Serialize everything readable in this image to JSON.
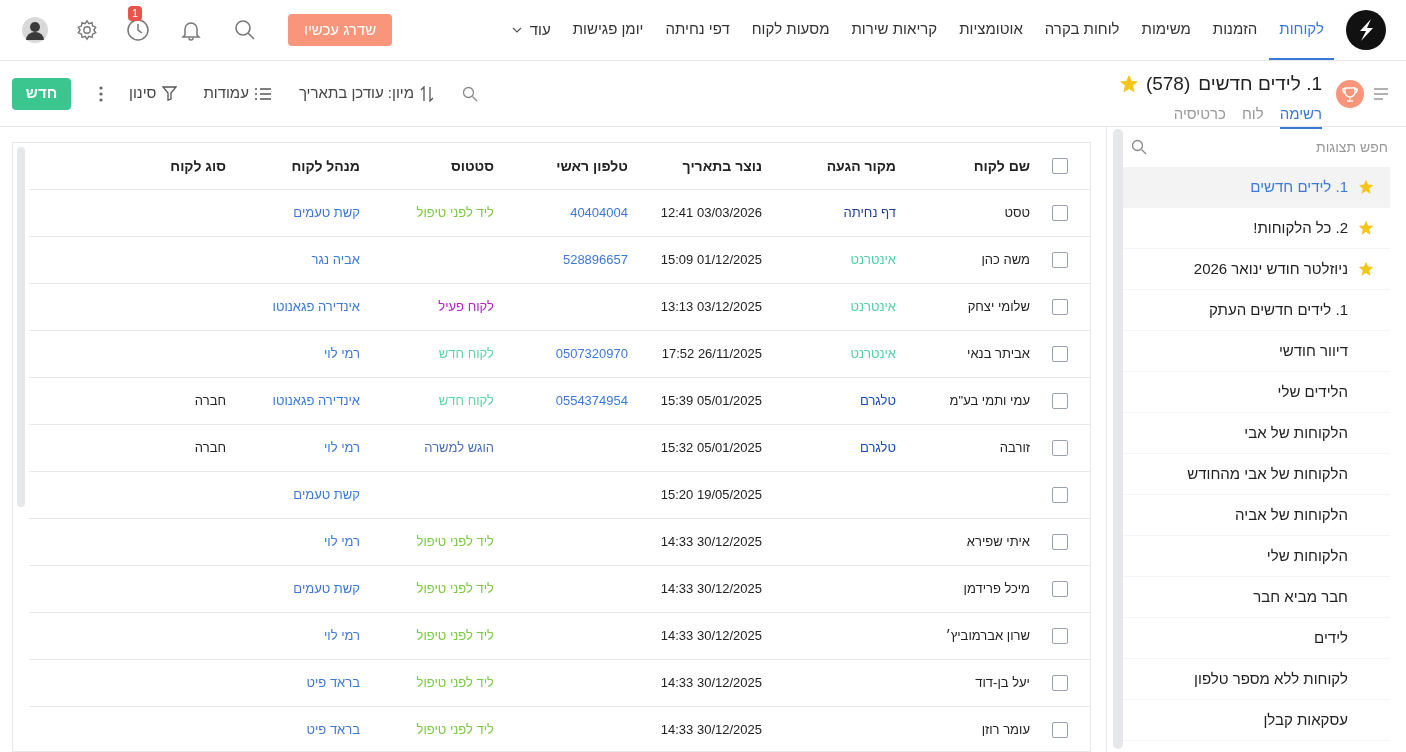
{
  "nav": {
    "items": [
      {
        "label": "לקוחות",
        "selected": true
      },
      {
        "label": "הזמנות",
        "selected": false
      },
      {
        "label": "משימות",
        "selected": false
      },
      {
        "label": "לוחות בקרה",
        "selected": false
      },
      {
        "label": "אוטומציות",
        "selected": false
      },
      {
        "label": "קריאות שירות",
        "selected": false
      },
      {
        "label": "מסעות לקוח",
        "selected": false
      },
      {
        "label": "דפי נחיתה",
        "selected": false
      },
      {
        "label": "יומן פגישות",
        "selected": false
      }
    ],
    "more": "עוד",
    "upgrade": "שדרג עכשיו",
    "history_badge": "1"
  },
  "view": {
    "title": "1. לידים חדשים",
    "count": "(578)",
    "starred": true,
    "tabs": [
      {
        "label": "רשימה",
        "selected": true
      },
      {
        "label": "לוח",
        "selected": false
      },
      {
        "label": "כרטיסיה",
        "selected": false
      }
    ],
    "sort": "מיון: עודכן בתאריך",
    "columns": "עמודות",
    "filter": "סינון",
    "new": "חדש"
  },
  "table": {
    "header_checked": false,
    "columns": [
      "שם לקוח",
      "מקור הגעה",
      "נוצר בתאריך",
      "טלפון ראשי",
      "סטטוס",
      "מנהל לקוח",
      "סוג לקוח"
    ],
    "rows": [
      {
        "checked": false,
        "name": "טסט",
        "source": {
          "text": "דף נחיתה",
          "color": "#1f3f8f"
        },
        "created": "12:41 03/03/2026",
        "phone": "40404004",
        "status": {
          "text": "ליד לפני טיפול",
          "color": "#7ac943"
        },
        "manager": "קשת טעמים"
      },
      {
        "checked": false,
        "name": "משה כהן",
        "source": {
          "text": "אינטרנט",
          "color": "#4fd0a5"
        },
        "created": "15:09 01/12/2025",
        "phone": "528896657",
        "manager": "אביה נגר"
      },
      {
        "checked": false,
        "name": "שלומי יצחק",
        "source": {
          "text": "אינטרנט",
          "color": "#4fd0a5"
        },
        "created": "13:13 03/12/2025",
        "status": {
          "text": "לקוח פעיל",
          "color": "#b620c8"
        },
        "manager": "אינדירה פגאנוטו"
      },
      {
        "checked": false,
        "name": "אביתר בנאי",
        "source": {
          "text": "אינטרנט",
          "color": "#4fd0a5"
        },
        "created": "17:52 26/11/2025",
        "phone": "0507320970",
        "status": {
          "text": "לקוח חדש",
          "color": "#5fd3a6"
        },
        "manager": "רמי לוי"
      },
      {
        "checked": false,
        "name": "עמי ותמי בע\"מ",
        "source": {
          "text": "טלגרם",
          "color": "#1a4bb8"
        },
        "created": "15:39 05/01/2025",
        "phone": "0554374954",
        "status": {
          "text": "לקוח חדש",
          "color": "#5fd3a6"
        },
        "manager": "אינדירה פגאנוטו",
        "type": "חברה"
      },
      {
        "checked": false,
        "name": "זורבה",
        "source": {
          "text": "טלגרם",
          "color": "#1a4bb8"
        },
        "created": "15:32 05/01/2025",
        "status": {
          "text": "הוגש למשרה",
          "color": "#4a6fb8"
        },
        "manager": "רמי לוי",
        "type": "חברה"
      },
      {
        "checked": false,
        "created": "15:20 19/05/2025",
        "manager": "קשת טעמים"
      },
      {
        "checked": false,
        "name": "איתי שפירא",
        "created": "14:33 30/12/2025",
        "status": {
          "text": "ליד לפני טיפול",
          "color": "#7ac943"
        },
        "manager": "רמי לוי"
      },
      {
        "checked": false,
        "name": "מיכל פרידמן",
        "created": "14:33 30/12/2025",
        "status": {
          "text": "ליד לפני טיפול",
          "color": "#7ac943"
        },
        "manager": "קשת טעמים"
      },
      {
        "checked": false,
        "name": "שרון אברמוביץ׳",
        "created": "14:33 30/12/2025",
        "status": {
          "text": "ליד לפני טיפול",
          "color": "#7ac943"
        },
        "manager": "רמי לוי"
      },
      {
        "checked": false,
        "name": "יעל בן-דוד",
        "created": "14:33 30/12/2025",
        "status": {
          "text": "ליד לפני טיפול",
          "color": "#7ac943"
        },
        "manager": "בראד פיט"
      },
      {
        "checked": false,
        "name": "עומר רוזן",
        "created": "14:33 30/12/2025",
        "status": {
          "text": "ליד לפני טיפול",
          "color": "#7ac943"
        },
        "manager": "בראד פיט"
      }
    ]
  },
  "sidebar": {
    "search": {
      "placeholder": "חפש תצוגות"
    },
    "items": [
      {
        "label": "1. לידים חדשים",
        "starred": true,
        "selected": true
      },
      {
        "label": "2. כל הלקוחות!",
        "starred": true,
        "selected": false
      },
      {
        "label": "ניוזלטר חודש ינואר 2026",
        "starred": true,
        "selected": false
      },
      {
        "label": "1. לידים חדשים העתק",
        "starred": false,
        "selected": false
      },
      {
        "label": "דיוור חודשי",
        "starred": false,
        "selected": false
      },
      {
        "label": "הלידים שלי",
        "starred": false,
        "selected": false
      },
      {
        "label": "הלקוחות של אבי",
        "starred": false,
        "selected": false
      },
      {
        "label": "הלקוחות של אבי מהחודש",
        "starred": false,
        "selected": false
      },
      {
        "label": "הלקוחות של אביה",
        "starred": false,
        "selected": false
      },
      {
        "label": "הלקוחות שלי",
        "starred": false,
        "selected": false
      },
      {
        "label": "חבר מביא חבר",
        "starred": false,
        "selected": false
      },
      {
        "label": "לידים",
        "starred": false,
        "selected": false
      },
      {
        "label": "לקוחות ללא מספר טלפון",
        "starred": false,
        "selected": false
      },
      {
        "label": "עסקאות קבלן",
        "starred": false,
        "selected": false
      }
    ]
  }
}
